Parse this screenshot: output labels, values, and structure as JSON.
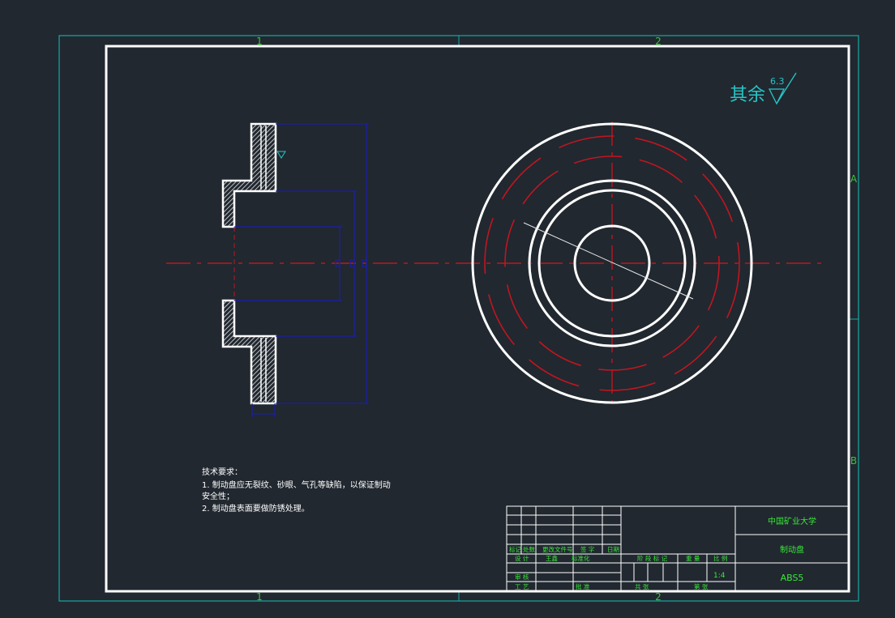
{
  "colors": {
    "background": "#212830",
    "outer_frame": "#17a9a3",
    "border": "#ffffff",
    "zone_text": "#34c934",
    "center_line": "#c0161f",
    "dimension": "#1b1fa8",
    "title_text": "#39e639",
    "roughness": "#26c6c6"
  },
  "zones": {
    "col_1": "1",
    "col_2": "2",
    "row_a": "A",
    "row_b": "B"
  },
  "roughness": {
    "prefix": "其余",
    "value": "6.3"
  },
  "technical_requirements": {
    "heading": "技术要求：",
    "line1": "1. 制动盘应无裂纹、砂眼、气孔等缺陷，以保证制动",
    "line2": "安全性；",
    "line3": "2. 制动盘表面要做防锈处理。"
  },
  "title_block": {
    "university": "中国矿业大学",
    "part_name": "制动盘",
    "material": "ABS5",
    "scale": "1:4",
    "headers": {
      "mark": "标记",
      "count": "处数",
      "change_doc": "更改文件号",
      "signature": "签 字",
      "date": "日期",
      "design": "设 计",
      "standardized_left": "王鑫",
      "standardization": "标准化",
      "stage_mark": "阶 段 标 记",
      "weight": "重 量",
      "scale_label": "比 例",
      "review": "审 核",
      "process": "工 艺",
      "approve": "批 准",
      "sheets_total": "共  张",
      "sheet_no": "第  张"
    }
  }
}
